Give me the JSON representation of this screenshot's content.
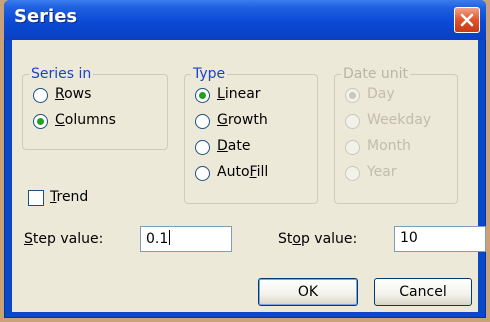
{
  "window": {
    "title": "Series"
  },
  "series_in": {
    "legend": "Series in",
    "options": [
      {
        "pre": "",
        "key": "R",
        "post": "ows",
        "checked": false
      },
      {
        "pre": "",
        "key": "C",
        "post": "olumns",
        "checked": true
      }
    ]
  },
  "type": {
    "legend": "Type",
    "options": [
      {
        "pre": "",
        "key": "L",
        "post": "inear",
        "checked": true
      },
      {
        "pre": "",
        "key": "G",
        "post": "rowth",
        "checked": false
      },
      {
        "pre": "",
        "key": "D",
        "post": "ate",
        "checked": false
      },
      {
        "pre": "Auto",
        "key": "F",
        "post": "ill",
        "checked": false
      }
    ]
  },
  "date_unit": {
    "legend": "Date unit",
    "options": [
      {
        "label": "Day",
        "checked": true
      },
      {
        "label": "Weekday",
        "checked": false
      },
      {
        "label": "Month",
        "checked": false
      },
      {
        "label": "Year",
        "checked": false
      }
    ]
  },
  "trend": {
    "pre": "",
    "key": "T",
    "post": "rend",
    "checked": false
  },
  "step": {
    "pre": "",
    "key": "S",
    "post": "tep value:",
    "value": "0.1"
  },
  "stop": {
    "pre": "St",
    "key": "o",
    "post": "p value:",
    "value": "10"
  },
  "buttons": {
    "ok": "OK",
    "cancel": "Cancel"
  }
}
